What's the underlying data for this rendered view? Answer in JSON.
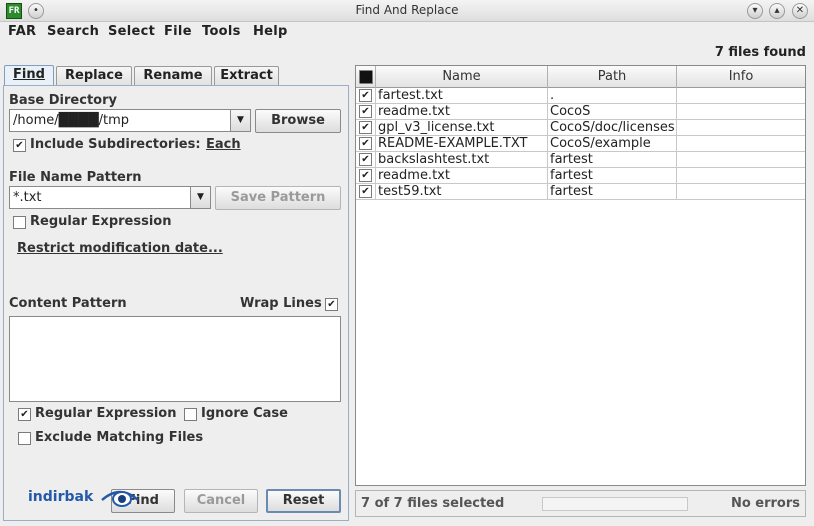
{
  "window": {
    "title": "Find And Replace",
    "app_icon_text": "FR"
  },
  "menu": {
    "items": [
      "FAR",
      "Search",
      "Select",
      "File",
      "Tools",
      "Help"
    ]
  },
  "summary": {
    "files_found": "7 files found"
  },
  "tabs": [
    {
      "label": "Find",
      "active": true
    },
    {
      "label": "Replace",
      "active": false
    },
    {
      "label": "Rename",
      "active": false
    },
    {
      "label": "Extract",
      "active": false
    }
  ],
  "find": {
    "base_directory_label": "Base Directory",
    "base_directory_value": "/home/████/tmp",
    "browse_label": "Browse",
    "include_subdirs_label": "Include Subdirectories:",
    "include_subdirs_checked": true,
    "each_link": "Each",
    "file_name_pattern_label": "File Name Pattern",
    "file_name_pattern_value": "*.txt",
    "save_pattern_label": "Save Pattern",
    "regex_filename_label": "Regular Expression",
    "regex_filename_checked": false,
    "restrict_date_link": "Restrict modification date...",
    "content_pattern_label": "Content Pattern",
    "wrap_lines_label": "Wrap Lines",
    "wrap_lines_checked": true,
    "content_pattern_value": "",
    "regex_content_label": "Regular Expression",
    "regex_content_checked": true,
    "ignore_case_label": "Ignore Case",
    "ignore_case_checked": false,
    "exclude_matching_label": "Exclude Matching Files",
    "exclude_matching_checked": false,
    "find_button": "Find",
    "cancel_button": "Cancel",
    "reset_button": "Reset"
  },
  "logo": {
    "text": "indirbak"
  },
  "table": {
    "columns": [
      "Name",
      "Path",
      "Info"
    ],
    "rows": [
      {
        "checked": true,
        "name": "fartest.txt",
        "path": ".",
        "info": ""
      },
      {
        "checked": true,
        "name": "readme.txt",
        "path": "CocoS",
        "info": ""
      },
      {
        "checked": true,
        "name": "gpl_v3_license.txt",
        "path": "CocoS/doc/licenses",
        "info": ""
      },
      {
        "checked": true,
        "name": "README-EXAMPLE.TXT",
        "path": "CocoS/example",
        "info": ""
      },
      {
        "checked": true,
        "name": "backslashtest.txt",
        "path": "fartest",
        "info": ""
      },
      {
        "checked": true,
        "name": "readme.txt",
        "path": "fartest",
        "info": ""
      },
      {
        "checked": true,
        "name": "test59.txt",
        "path": "fartest",
        "info": ""
      }
    ]
  },
  "status": {
    "selection": "7 of 7 files selected",
    "errors": "No errors"
  }
}
